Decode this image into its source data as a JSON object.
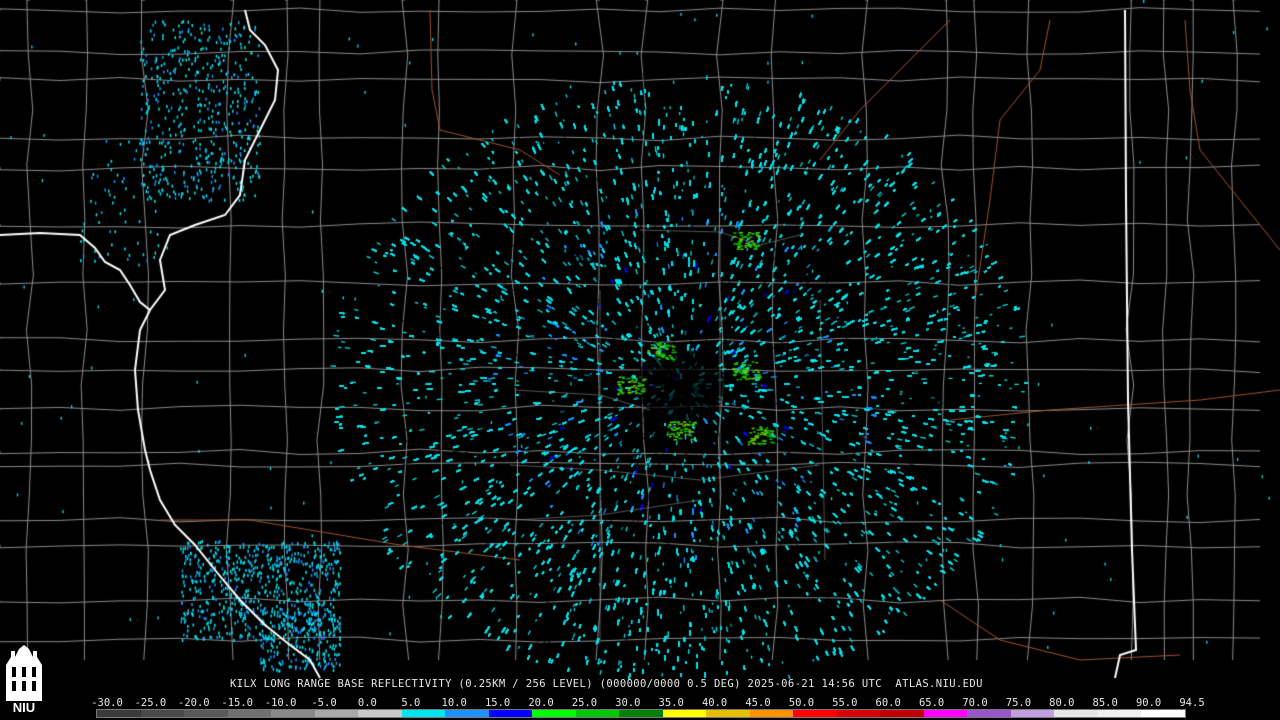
{
  "map": {
    "product_caption": "KILX LONG RANGE BASE REFLECTIVITY (0.25KM / 256 LEVEL) (000000/0000 0.5 DEG) 2025-06-21 14:56 UTC  ATLAS.NIU.EDU",
    "background_color": "#000000",
    "state_border_color": "#ffffff",
    "county_line_color": "#8c8c8c",
    "river_color": "#a0522d",
    "echo_colors": [
      "#00e5ee",
      "#1e90ff",
      "#0000ff",
      "#00c800",
      "#66cc00"
    ]
  },
  "scale": {
    "labels": [
      "-30.0",
      "-25.0",
      "-20.0",
      "-15.0",
      "-10.0",
      "-5.0",
      "0.0",
      "5.0",
      "10.0",
      "15.0",
      "20.0",
      "25.0",
      "30.0",
      "35.0",
      "40.0",
      "45.0",
      "50.0",
      "55.0",
      "60.0",
      "65.0",
      "70.0",
      "75.0",
      "80.0",
      "85.0",
      "90.0",
      "94.5"
    ],
    "colors": [
      "#3a3a3a",
      "#4a4a4a",
      "#5a5a5a",
      "#707070",
      "#8a8a8a",
      "#a8a8a8",
      "#c8c8c8",
      "#00e5ee",
      "#1e90ff",
      "#0000ff",
      "#00ff00",
      "#00c800",
      "#008000",
      "#ffff00",
      "#e7c000",
      "#ff9000",
      "#ff0000",
      "#d60000",
      "#c00000",
      "#ff00ff",
      "#9955c9",
      "#c0a0e0",
      "#e6e6e6",
      "#f0f0f0",
      "#ffffff"
    ]
  },
  "logo": {
    "text": "NIU"
  }
}
